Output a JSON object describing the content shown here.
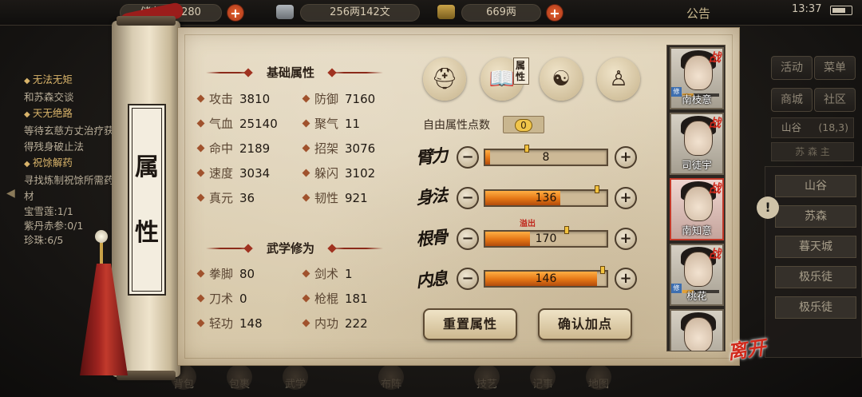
{
  "topbar": {
    "bag_label": "储存",
    "bag_count": "11/280",
    "money_copper": "256两142文",
    "gold": "669两",
    "announcement": "公告",
    "time": "13:37"
  },
  "quest_log": [
    {
      "title": "无法无矩",
      "body": "和苏森交谈"
    },
    {
      "title": "天无绝路",
      "body": "等待玄慈方丈治疗获得残身破止法"
    },
    {
      "title": "祝馀解药",
      "body": "寻找炼制祝馀所需药材"
    }
  ],
  "quest_progress": [
    "宝雪莲:1/1",
    "紫丹赤参:0/1",
    "珍珠:6/5"
  ],
  "scroll_title": [
    "属",
    "性"
  ],
  "basic": {
    "title": "基础属性",
    "stats": [
      {
        "label": "攻击",
        "value": "3810"
      },
      {
        "label": "防御",
        "value": "7160"
      },
      {
        "label": "气血",
        "value": "25140"
      },
      {
        "label": "聚气",
        "value": "11"
      },
      {
        "label": "命中",
        "value": "2189"
      },
      {
        "label": "招架",
        "value": "3076"
      },
      {
        "label": "速度",
        "value": "3034"
      },
      {
        "label": "躲闪",
        "value": "3102"
      },
      {
        "label": "真元",
        "value": "36"
      },
      {
        "label": "韧性",
        "value": "921"
      }
    ]
  },
  "martial": {
    "title": "武学修为",
    "stats": [
      {
        "label": "拳脚",
        "value": "80"
      },
      {
        "label": "剑术",
        "value": "1"
      },
      {
        "label": "刀术",
        "value": "0"
      },
      {
        "label": "枪棍",
        "value": "181"
      },
      {
        "label": "轻功",
        "value": "148"
      },
      {
        "label": "内功",
        "value": "222"
      }
    ]
  },
  "tabs": {
    "attr_label": "属性"
  },
  "points": {
    "free_label": "自由属性点数",
    "free_value": "0"
  },
  "attributes": [
    {
      "name": "臂力",
      "value": "8",
      "fill": 0.04
    },
    {
      "name": "身法",
      "value": "136",
      "fill": 0.62
    },
    {
      "name": "根骨",
      "value": "170",
      "fill": 0.37
    },
    {
      "name": "内息",
      "value": "146",
      "fill": 0.92
    }
  ],
  "overflow_label": "溢出",
  "buttons": {
    "reset": "重置属性",
    "confirm": "确认加点",
    "minus": "−",
    "plus": "+"
  },
  "party": [
    {
      "name": "南枝意",
      "battle": "战",
      "tag": "修"
    },
    {
      "name": "司徒宇",
      "battle": "战",
      "tag": ""
    },
    {
      "name": "南知意",
      "battle": "战",
      "tag": ""
    },
    {
      "name": "桃花",
      "battle": "战",
      "tag": "修"
    },
    {
      "name": "",
      "battle": "",
      "tag": ""
    }
  ],
  "leave": "离开",
  "side_menu": {
    "activity": "活动",
    "menu": "菜单",
    "shop": "商城",
    "community": "社区"
  },
  "location": {
    "name": "山谷",
    "count": "(18,3)",
    "sub": "苏 森 主",
    "list": [
      "山谷",
      "苏森",
      "暮天城",
      "极乐徒",
      "极乐徒"
    ]
  },
  "bottom_nav": [
    "背包",
    "包裹",
    "武学",
    "布阵",
    "技艺",
    "记事",
    "地图"
  ],
  "colors": {
    "paper": "#e4d8bf",
    "accent_red": "#c0291e",
    "bar_orange": "#e37515"
  }
}
